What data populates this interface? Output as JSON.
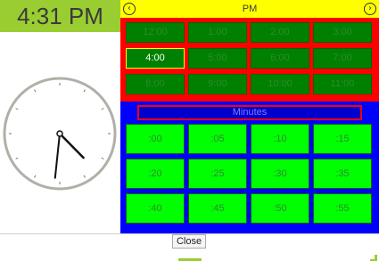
{
  "time_display": "4:31 PM",
  "header": {
    "title": "PM",
    "prev_icon": "chevron-left-circle",
    "next_icon": "chevron-right-circle"
  },
  "hours": [
    "12:00",
    "1:00",
    "2:00",
    "3:00",
    "4:00",
    "5:00",
    "6:00",
    "7:00",
    "8:00",
    "9:00",
    "10:00",
    "11:00"
  ],
  "selected_hour": "4:00",
  "minutes_label": "Minutes",
  "minutes": [
    ":00",
    ":05",
    ":10",
    ":15",
    ":20",
    ":25",
    ":30",
    ":35",
    ":40",
    ":45",
    ":50",
    ":55"
  ],
  "clock": {
    "hour": 4,
    "minute": 31
  },
  "footer": {
    "close_label": "Close"
  },
  "colors": {
    "time_bg": "#9acd32",
    "header_bg": "#ffff00",
    "hours_bg": "#ff0000",
    "hour_cell": "#008000",
    "minutes_bg": "#0000ff",
    "minute_cell": "#00ff00"
  }
}
